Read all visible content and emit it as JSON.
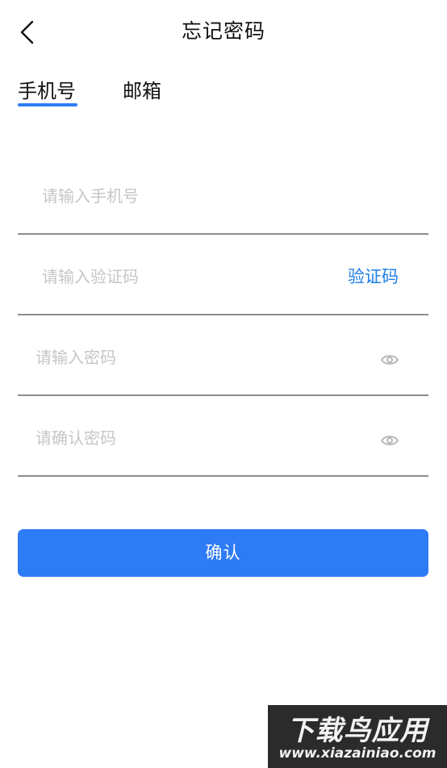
{
  "header": {
    "title": "忘记密码",
    "back_icon": "chevron-left-icon"
  },
  "tabs": [
    {
      "label": "手机号",
      "active": true
    },
    {
      "label": "邮箱",
      "active": false
    }
  ],
  "form": {
    "phone": {
      "placeholder": "请输入手机号",
      "value": ""
    },
    "code": {
      "placeholder": "请输入验证码",
      "value": "",
      "button_label": "验证码"
    },
    "password": {
      "placeholder": "请输入密码",
      "value": "",
      "icon": "eye-icon"
    },
    "confirm_password": {
      "placeholder": "请确认密码",
      "value": "",
      "icon": "eye-icon"
    }
  },
  "confirm_button": {
    "label": "确认"
  },
  "watermark": {
    "line1": "下载鸟应用",
    "line2": "www.xiazainiao.com"
  },
  "colors": {
    "accent": "#2e7bf6",
    "link": "#1f7ee6",
    "divider": "#8c8c8c",
    "placeholder": "#c6c6c6"
  }
}
